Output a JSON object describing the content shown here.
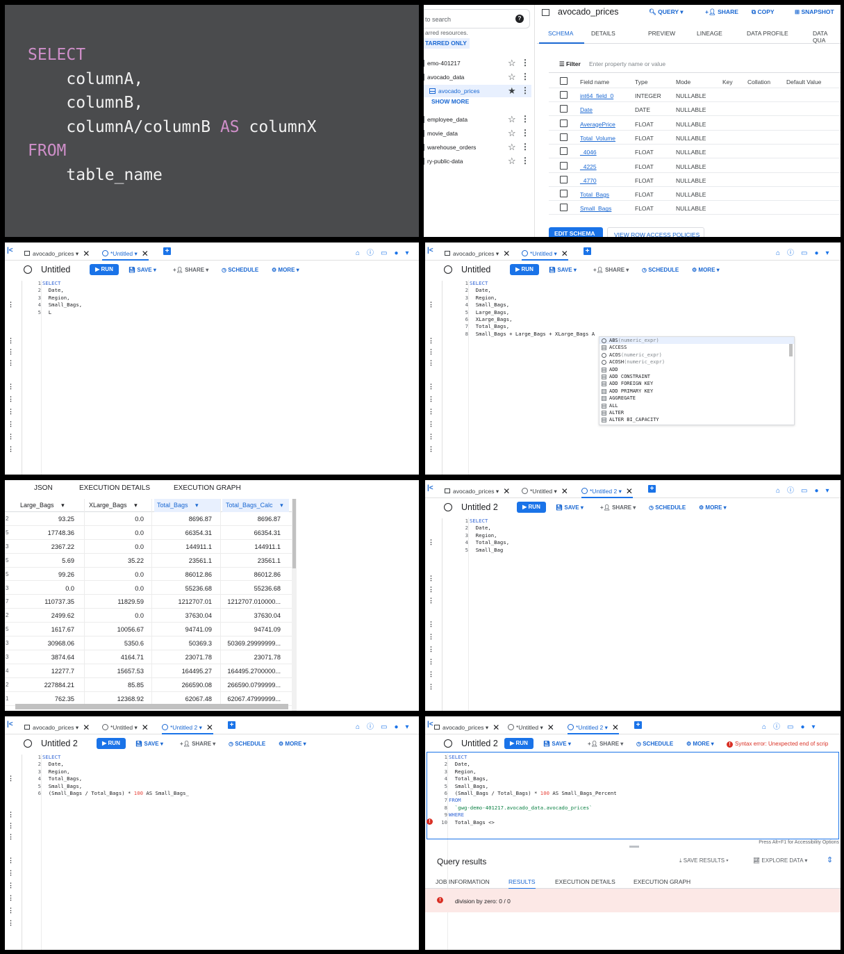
{
  "sql_slide": {
    "lines": [
      {
        "indent": "",
        "kw": "SELECT",
        "text": ""
      },
      {
        "indent": "    ",
        "kw": "",
        "text": "columnA,"
      },
      {
        "indent": "    ",
        "kw": "",
        "text": "columnB,"
      },
      {
        "indent": "    ",
        "kw": "",
        "text": "columnA/columnB ",
        "kw2": "AS",
        "text2": " columnX"
      },
      {
        "indent": "",
        "kw": "FROM",
        "text": ""
      },
      {
        "indent": "    ",
        "kw": "",
        "text": "table_name"
      }
    ]
  },
  "schema_panel": {
    "search_placeholder": "to search",
    "help_icon": "?",
    "starred_note": "arred resources.",
    "starred_only": "TARRED ONLY",
    "tree": [
      {
        "label": "emo-401217",
        "selected": false,
        "starred": false
      },
      {
        "label": "avocado_data",
        "selected": false,
        "starred": false
      },
      {
        "label": "avocado_prices",
        "selected": true,
        "starred": true
      },
      {
        "label": "employee_data",
        "selected": false,
        "starred": false
      },
      {
        "label": "movie_data",
        "selected": false,
        "starred": false
      },
      {
        "label": "warehouse_orders",
        "selected": false,
        "starred": false
      },
      {
        "label": "ry-public-data",
        "selected": false,
        "starred": false
      }
    ],
    "show_more": "SHOW MORE",
    "table_title": "avocado_prices",
    "actions": [
      "QUERY",
      "SHARE",
      "COPY",
      "SNAPSHOT"
    ],
    "tabs": [
      "SCHEMA",
      "DETAILS",
      "PREVIEW",
      "LINEAGE",
      "DATA PROFILE",
      "DATA QUA"
    ],
    "active_tab": "SCHEMA",
    "filter_label": "Filter",
    "filter_placeholder": "Enter property name or value",
    "columns": [
      "Field name",
      "Type",
      "Mode",
      "Key",
      "Collation",
      "Default Value"
    ],
    "fields": [
      {
        "name": "int64_field_0",
        "type": "INTEGER",
        "mode": "NULLABLE"
      },
      {
        "name": "Date",
        "type": "DATE",
        "mode": "NULLABLE"
      },
      {
        "name": "AveragePrice",
        "type": "FLOAT",
        "mode": "NULLABLE"
      },
      {
        "name": "Total_Volume",
        "type": "FLOAT",
        "mode": "NULLABLE"
      },
      {
        "name": "_4046",
        "type": "FLOAT",
        "mode": "NULLABLE"
      },
      {
        "name": "_4225",
        "type": "FLOAT",
        "mode": "NULLABLE"
      },
      {
        "name": "_4770",
        "type": "FLOAT",
        "mode": "NULLABLE"
      },
      {
        "name": "Total_Bags",
        "type": "FLOAT",
        "mode": "NULLABLE"
      },
      {
        "name": "Small_Bags",
        "type": "FLOAT",
        "mode": "NULLABLE"
      }
    ],
    "edit_schema": "EDIT SCHEMA",
    "view_policies": "VIEW ROW ACCESS POLICIES"
  },
  "toolbar": {
    "run": "RUN",
    "save": "SAVE",
    "share": "SHARE",
    "schedule": "SCHEDULE",
    "more": "MORE",
    "tab_table": "avocado_prices",
    "tab_untitled": "*Untitled",
    "tab_untitled2": "*Untitled 2"
  },
  "editor_a": {
    "title": "Untitled",
    "code": [
      "SELECT",
      "  Date,",
      "  Region,",
      "  Small_Bags,",
      "  L"
    ]
  },
  "editor_b": {
    "title": "Untitled",
    "code": [
      "SELECT",
      "  Date,",
      "  Region,",
      "  Small_Bags,",
      "  Large_Bags,",
      "  XLarge_Bags,",
      "  Total_Bags,",
      "  Small_Bags + Large_Bags + XLarge_Bags A"
    ],
    "autocomplete": [
      {
        "name": "ABS",
        "args": "(numeric_expr)",
        "kind": "fn"
      },
      {
        "name": "ACCESS",
        "args": "",
        "kind": "kw"
      },
      {
        "name": "ACOS",
        "args": "(numeric_expr)",
        "kind": "fn"
      },
      {
        "name": "ACOSH",
        "args": "(numeric_expr)",
        "kind": "fn"
      },
      {
        "name": "ADD",
        "args": "",
        "kind": "kw"
      },
      {
        "name": "ADD CONSTRAINT",
        "args": "",
        "kind": "kw"
      },
      {
        "name": "ADD FOREIGN KEY",
        "args": "",
        "kind": "kw"
      },
      {
        "name": "ADD PRIMARY KEY",
        "args": "",
        "kind": "kw"
      },
      {
        "name": "AGGREGATE",
        "args": "",
        "kind": "kw"
      },
      {
        "name": "ALL",
        "args": "",
        "kind": "kw"
      },
      {
        "name": "ALTER",
        "args": "",
        "kind": "kw"
      },
      {
        "name": "ALTER BI_CAPACITY",
        "args": "",
        "kind": "kw"
      }
    ]
  },
  "results_panel": {
    "tabs": [
      "JSON",
      "EXECUTION DETAILS",
      "EXECUTION GRAPH"
    ],
    "headers": [
      "Large_Bags",
      "XLarge_Bags",
      "Total_Bags",
      "Total_Bags_Calc"
    ],
    "row_index_digits": [
      "2",
      "5",
      "3",
      "5",
      "5",
      "3",
      "7",
      "2",
      "5",
      "3",
      "3",
      "4",
      "2",
      "1"
    ],
    "rows": [
      [
        "93.25",
        "0.0",
        "8696.87",
        "8696.87"
      ],
      [
        "17748.36",
        "0.0",
        "66354.31",
        "66354.31"
      ],
      [
        "2367.22",
        "0.0",
        "144911.1",
        "144911.1"
      ],
      [
        "5.69",
        "35.22",
        "23561.1",
        "23561.1"
      ],
      [
        "99.26",
        "0.0",
        "86012.86",
        "86012.86"
      ],
      [
        "0.0",
        "0.0",
        "55236.68",
        "55236.68"
      ],
      [
        "110737.35",
        "11829.59",
        "1212707.01",
        "1212707.010000..."
      ],
      [
        "2499.62",
        "0.0",
        "37630.04",
        "37630.04"
      ],
      [
        "1617.67",
        "10056.67",
        "94741.09",
        "94741.09"
      ],
      [
        "30968.06",
        "5350.6",
        "50369.3",
        "50369.29999999..."
      ],
      [
        "3874.64",
        "4164.71",
        "23071.78",
        "23071.78"
      ],
      [
        "12277.7",
        "15657.53",
        "164495.27",
        "164495.2700000..."
      ],
      [
        "227884.21",
        "85.85",
        "266590.08",
        "266590.0799999..."
      ],
      [
        "762.35",
        "12368.92",
        "62067.48",
        "62067.47999999..."
      ]
    ]
  },
  "editor_c": {
    "title": "Untitled 2",
    "code": [
      "SELECT",
      "  Date,",
      "  Region,",
      "  Total_Bags,",
      "  Small_Bag"
    ]
  },
  "editor_d": {
    "title": "Untitled 2",
    "code": [
      "SELECT",
      "  Date,",
      "  Region,",
      "  Total_Bags,",
      "  Small_Bags,",
      "  (Small_Bags / Total_Bags) * 100 AS Small_Bags_"
    ]
  },
  "editor_e": {
    "title": "Untitled 2",
    "error": "Syntax error: Unexpected end of scrip",
    "code": [
      "SELECT",
      "  Date,",
      "  Region,",
      "  Total_Bags,",
      "  Small_Bags,",
      "  (Small_Bags / Total_Bags) * 100 AS Small_Bags_Percent",
      "FROM",
      "  `gwg-demo-401217.avocado_data.avocado_prices`",
      "WHERE",
      "  Total_Bags <>"
    ],
    "accessibility_hint": "Press Alt+F1 for Accessibility Options",
    "results_title": "Query results",
    "save_results": "SAVE RESULTS",
    "explore_data": "EXPLORE DATA",
    "result_tabs": [
      "JOB INFORMATION",
      "RESULTS",
      "EXECUTION DETAILS",
      "EXECUTION GRAPH"
    ],
    "active_result_tab": "RESULTS",
    "result_error": "division by zero: 0 / 0"
  }
}
